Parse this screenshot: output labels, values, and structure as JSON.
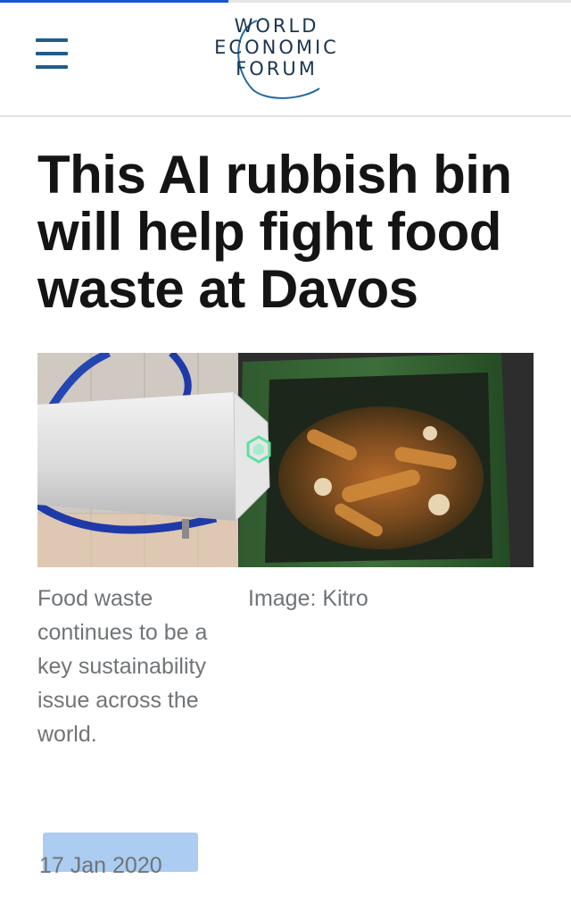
{
  "reading_progress": 0.4,
  "header": {
    "menu_icon": "hamburger-menu-icon",
    "logo": {
      "lines": [
        "WORLD",
        "ECONOMIC",
        "FORUM"
      ],
      "color": "#1b3550"
    }
  },
  "article": {
    "title": "This AI rubbish bin will help fight food waste at Davos",
    "image": {
      "caption": "Food waste continues to be a key sustainability issue across the world.",
      "credit": "Image: Kitro"
    },
    "date": "17 Jan 2020"
  },
  "colors": {
    "menu": "#1f5d8a",
    "progress": "#1a55d6",
    "title": "#141414",
    "meta_text": "#707477",
    "date_highlight": "#9ec3ee"
  }
}
